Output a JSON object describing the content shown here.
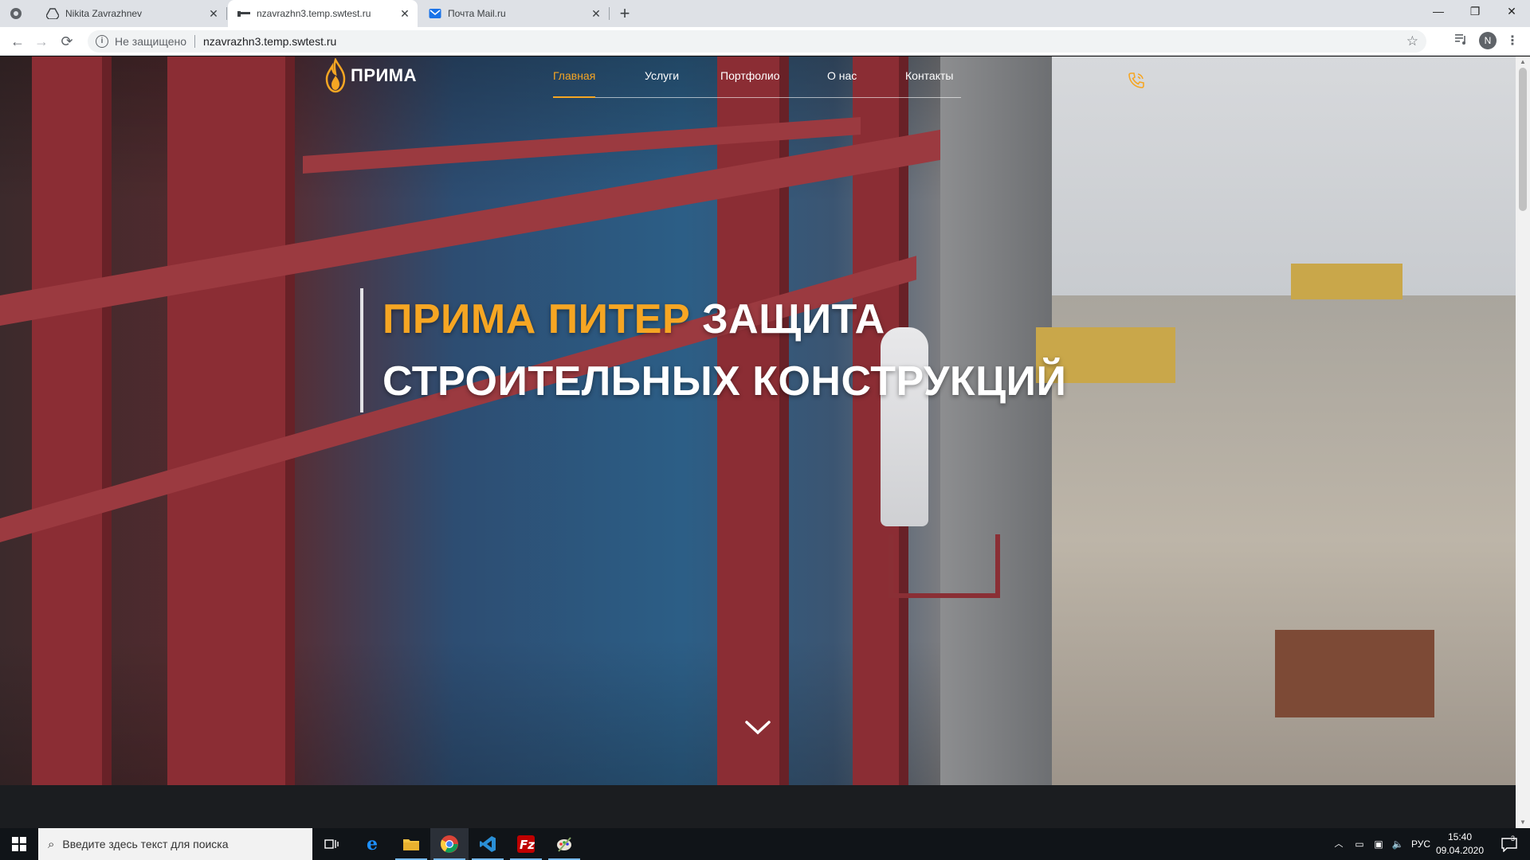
{
  "browser": {
    "tabs": [
      {
        "title": "Nikita Zavrazhnev",
        "icon": "drive-icon",
        "active": false
      },
      {
        "title": "nzavrazhn3.temp.swtest.ru",
        "icon": "site-favicon",
        "active": true
      },
      {
        "title": "Почта Mail.ru",
        "icon": "mail-icon",
        "active": false
      }
    ],
    "address": {
      "security_label": "Не защищено",
      "url": "nzavrazhn3.temp.swtest.ru"
    },
    "profile_initial": "N"
  },
  "site": {
    "logo_text": "ПРИМА",
    "nav": [
      {
        "label": "Главная",
        "active": true
      },
      {
        "label": "Услуги",
        "active": false
      },
      {
        "label": "Портфолио",
        "active": false
      },
      {
        "label": "О нас",
        "active": false
      },
      {
        "label": "Контакты",
        "active": false
      }
    ],
    "hero": {
      "headline_accent": "ПРИМА ПИТЕР",
      "headline_rest": "ЗАЩИТА",
      "headline_line2": "СТРОИТЕЛЬНЫХ КОНСТРУКЦИЙ"
    },
    "colors": {
      "accent": "#f6a623",
      "text": "#ffffff"
    }
  },
  "taskbar": {
    "search_placeholder": "Введите здесь текст для поиска",
    "language": "РУС",
    "time": "15:40",
    "date": "09.04.2020",
    "notifications": "3"
  }
}
